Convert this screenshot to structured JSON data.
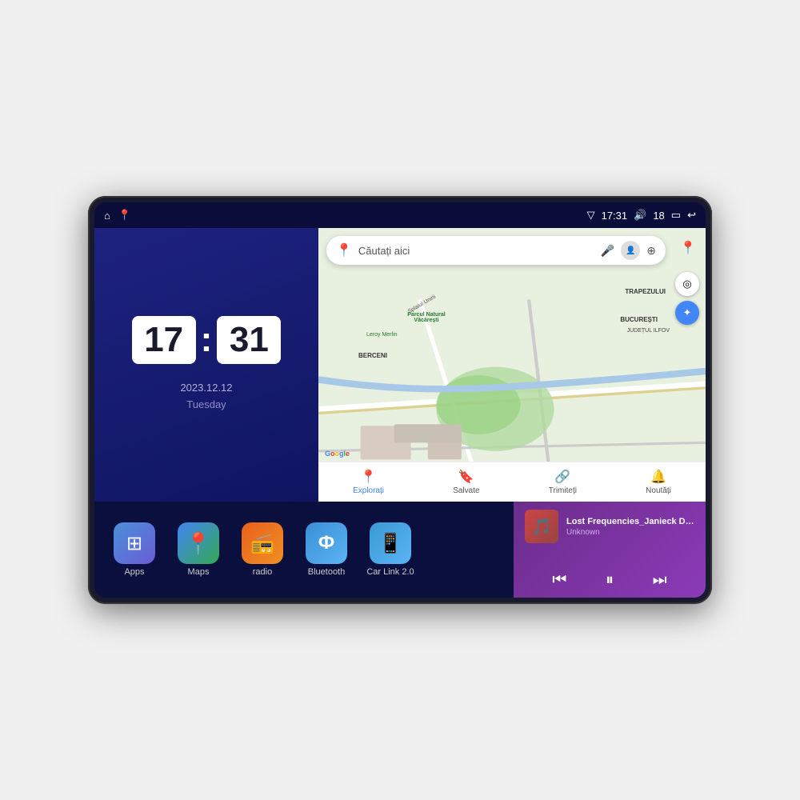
{
  "device": {
    "screen_bg": "#1a1d5e"
  },
  "status_bar": {
    "left_icons": [
      "⌂",
      "📍"
    ],
    "time": "17:31",
    "signal_icon": "▽",
    "volume_icon": "🔊",
    "volume_level": "18",
    "battery_icon": "▭",
    "back_icon": "↩"
  },
  "clock": {
    "hours": "17",
    "minutes": "31",
    "date": "2023.12.12",
    "day": "Tuesday"
  },
  "map": {
    "search_placeholder": "Căutați aici",
    "trapezului": "TRAPEZULUI",
    "bucuresti": "BUCUREȘTI",
    "judet": "JUDEȚUL ILFOV",
    "berceni": "BERCENI",
    "parcul": "Parcul Natural Văcărești",
    "leroy": "Leroy Merlin",
    "splai": "Splaiul Unirii",
    "google": "Google",
    "tabs": [
      {
        "label": "Explorați",
        "icon": "📍",
        "active": true
      },
      {
        "label": "Salvate",
        "icon": "🔖",
        "active": false
      },
      {
        "label": "Trimiteți",
        "icon": "🔗",
        "active": false
      },
      {
        "label": "Noutăți",
        "icon": "🔔",
        "active": false
      }
    ]
  },
  "apps": [
    {
      "id": "apps",
      "label": "Apps",
      "icon": "⊞",
      "bg_class": "icon-apps"
    },
    {
      "id": "maps",
      "label": "Maps",
      "icon": "📍",
      "bg_class": "icon-maps"
    },
    {
      "id": "radio",
      "label": "radio",
      "icon": "📻",
      "bg_class": "icon-radio"
    },
    {
      "id": "bluetooth",
      "label": "Bluetooth",
      "icon": "⚡",
      "bg_class": "icon-bluetooth"
    },
    {
      "id": "carlink",
      "label": "Car Link 2.0",
      "icon": "📱",
      "bg_class": "icon-carlink"
    }
  ],
  "music": {
    "title": "Lost Frequencies_Janieck Devy-...",
    "artist": "Unknown",
    "prev_icon": "⏮",
    "play_icon": "⏸",
    "next_icon": "⏭"
  }
}
